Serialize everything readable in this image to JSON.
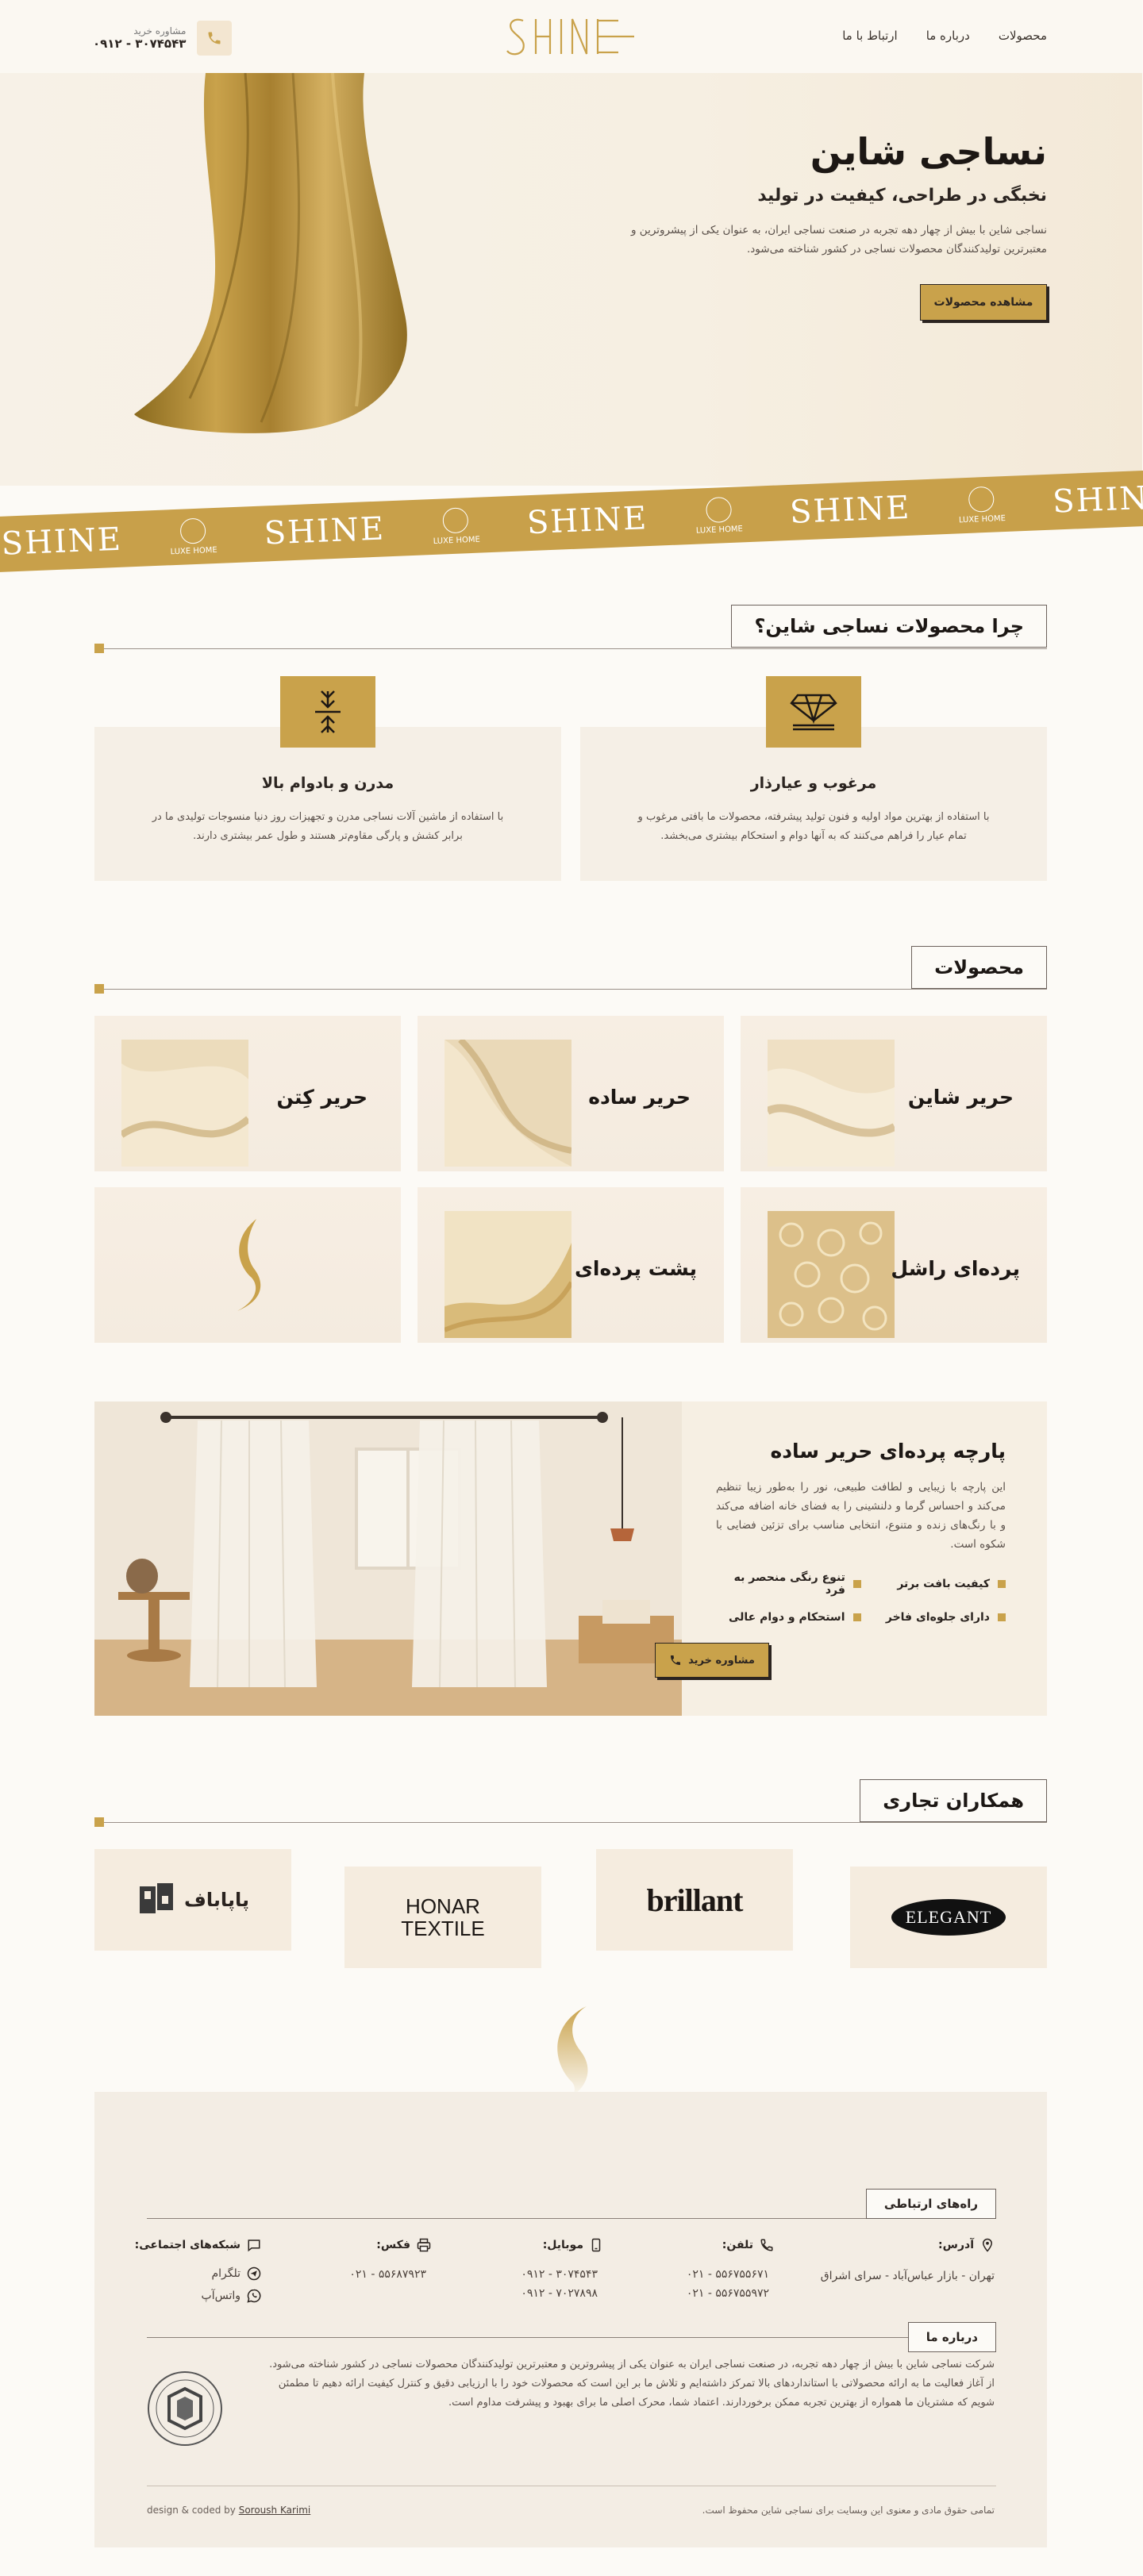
{
  "header": {
    "nav": [
      "محصولات",
      "درباره ما",
      "ارتباط با ما"
    ],
    "logo_text": "SHINE",
    "phone_label": "مشاوره خرید",
    "phone_number": "۰۹۱۲ - ۳۰۷۴۵۴۳"
  },
  "hero": {
    "title": "نساجی شاین",
    "subtitle": "نخبگی در طراحی، کیفیت در تولید",
    "description": "نساجی شاین با بیش از چهار دهه تجربه در صنعت نساجی ایران، به عنوان یکی از پیشروترین و معتبرترین تولیدکنندگان محصولات نساجی در کشور شناخته می‌شود.",
    "button": "مشاهده محصولات"
  },
  "ribbon": {
    "logo": "SHINE",
    "badge": "LUXE HOME"
  },
  "why": {
    "title": "چرا محصولات نساجی شاین؟",
    "cards": [
      {
        "icon": "diamond-icon",
        "title": "مرغوب و عیارذار",
        "text": "با استفاده از بهترین مواد اولیه و فنون تولید پیشرفته، محصولات ما بافتی مرغوب و تمام عیار را فراهم می‌کنند که به آنها دوام و استحکام بیشتری می‌بخشد."
      },
      {
        "icon": "compress-arrows-icon",
        "title": "مدرن و بادوام بالا",
        "text": "با استفاده از ماشین آلات نساجی مدرن و تجهیزات روز دنیا منسوجات تولیدی ما در برابر کشش و پارگی مقاوم‌تر هستند و طول عمر بیشتری دارند."
      }
    ]
  },
  "products": {
    "title": "محصولات",
    "items": [
      {
        "name": "حریر شاین"
      },
      {
        "name": "حریر ساده"
      },
      {
        "name": "حریر کِتن"
      },
      {
        "name": "پرده‌ای راشل"
      },
      {
        "name": "پشت پرده‌ای"
      },
      {
        "name": ""
      }
    ]
  },
  "feature": {
    "title": "پارچه پرده‌ای حریر ساده",
    "text": "این پارچه با زیبایی و لطافت طبیعی، نور را به‌طور زیبا تنظیم می‌کند و احساس گرما و دلنشینی را به فضای خانه اضافه می‌کند و با رنگ‌های زنده و متنوع، انتخابی مناسب برای تزئین فضایی با شکوه است.",
    "bullets": [
      "کیفیت بافت برتر",
      "تنوع رنگی منحصر به فرد",
      "دارای جلوه‌ای فاخر",
      "استحکام و دوام عالی"
    ],
    "button": "مشاوره خرید"
  },
  "partners": {
    "title": "همکاران تجاری",
    "logos": [
      "ELEGANT",
      "brillant",
      "HONAR TEXTILE",
      "پاپاباف"
    ]
  },
  "footer": {
    "contact_title": "راه‌های ارتباطی",
    "address_label": "آدرس:",
    "address": "تهران - بازار عباس‌آباد - سرای اشراق",
    "phone_label": "تلفن:",
    "phones": [
      "۰۲۱ - ۵۵۶۷۵۵۶۷۱",
      "۰۲۱ - ۵۵۶۷۵۵۹۷۲"
    ],
    "mobile_label": "موبایل:",
    "mobiles": [
      "۰۹۱۲ - ۳۰۷۴۵۴۳",
      "۰۹۱۲ - ۷۰۲۷۸۹۸"
    ],
    "fax_label": "فکس:",
    "fax": "۰۲۱ - ۵۵۶۸۷۹۲۳",
    "social_label": "شبکه‌های اجتماعی:",
    "socials": [
      "تلگرام",
      "واتس‌آپ"
    ],
    "about_title": "درباره ما",
    "about": "شرکت نساجی شاین با بیش از چهار دهه تجربه، در صنعت نساجی ایران به عنوان یکی از پیشروترین و معتبرترین تولیدکنندگان محصولات نساجی در کشور شناخته می‌شود. از آغاز فعالیت ما به ارائه محصولاتی با استانداردهای بالا تمرکز داشته‌ایم و تلاش ما بر این است که محصولات خود را با ارزیابی دقیق و کنترل کیفیت ارائه دهیم تا مطمئن شویم که مشتریان ما همواره از بهترین تجربه ممکن برخوردارند. اعتماد شما، محرک اصلی ما برای بهبود و پیشرفت مداوم است.",
    "copyright": "تمامی حقوق مادی و معنوی این وبسایت برای نساجی شاین محفوظ است.",
    "credit_prefix": "design & coded by ",
    "credit_name": "Soroush Karimi"
  },
  "colors": {
    "accent": "#c9a24b",
    "dark": "#2b2420",
    "background": "#fcfaf6"
  }
}
